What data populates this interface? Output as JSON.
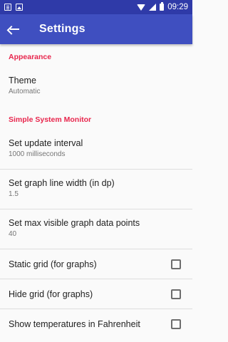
{
  "status_bar": {
    "time": "09:29"
  },
  "toolbar": {
    "title": "Settings"
  },
  "sections": {
    "appearance": {
      "header": "Appearance",
      "theme": {
        "title": "Theme",
        "summary": "Automatic"
      }
    },
    "monitor": {
      "header": "Simple System Monitor",
      "update_interval": {
        "title": "Set update interval",
        "summary": "1000 milliseconds"
      },
      "line_width": {
        "title": "Set graph line width (in dp)",
        "summary": "1.5"
      },
      "max_points": {
        "title": "Set max visible graph data points",
        "summary": "40"
      },
      "static_grid": {
        "title": "Static grid (for graphs)",
        "checked": false
      },
      "hide_grid": {
        "title": "Hide grid (for graphs)",
        "checked": false
      },
      "fahrenheit": {
        "title": "Show temperatures in Fahrenheit",
        "checked": false
      }
    }
  },
  "colors": {
    "status_bar": "#2f3aa8",
    "toolbar": "#3f4fc0",
    "accent": "#e8264d"
  }
}
